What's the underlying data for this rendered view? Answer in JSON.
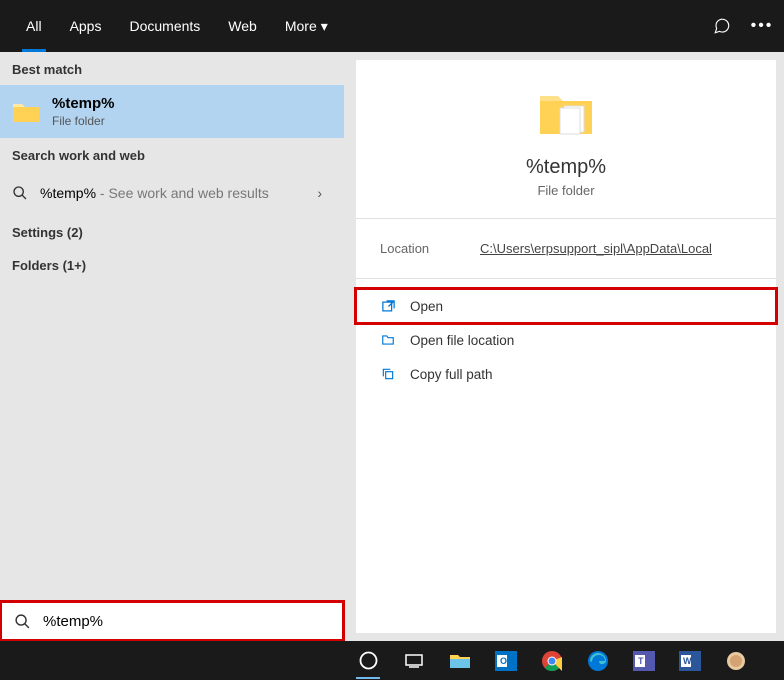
{
  "tabs": {
    "all": "All",
    "apps": "Apps",
    "documents": "Documents",
    "web": "Web",
    "more": "More"
  },
  "sections": {
    "best": "Best match",
    "searchweb": "Search work and web",
    "settings": "Settings (2)",
    "folders": "Folders (1+)"
  },
  "best": {
    "title": "%temp%",
    "sub": "File folder"
  },
  "webresult": {
    "term": "%temp%",
    "hint": " - See work and web results"
  },
  "preview": {
    "title": "%temp%",
    "sub": "File folder"
  },
  "location": {
    "label": "Location",
    "path": "C:\\Users\\erpsupport_sipl\\AppData\\Local"
  },
  "actions": {
    "open": "Open",
    "openloc": "Open file location",
    "copypath": "Copy full path"
  },
  "search": {
    "value": "%temp%"
  }
}
